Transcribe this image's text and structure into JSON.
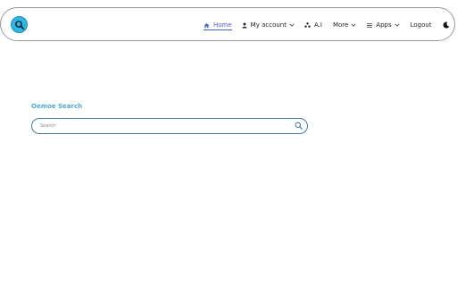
{
  "nav": {
    "home_label": "Home",
    "account_label": "My account",
    "ai_label": "A.I",
    "more_label": "More",
    "apps_label": "Apps",
    "logout_label": "Logout"
  },
  "search": {
    "title": "Oemoe Search",
    "placeholder": "Search"
  },
  "colors": {
    "accent": "#3d5fd6",
    "logo": "#2bb6e6",
    "title": "#4aa9d6",
    "search_border": "#3f78b8"
  },
  "icons": [
    "logo-search-icon",
    "home-icon",
    "user-icon",
    "ai-network-icon",
    "chevron-down-icon",
    "menu-icon",
    "moon-icon",
    "search-icon"
  ]
}
